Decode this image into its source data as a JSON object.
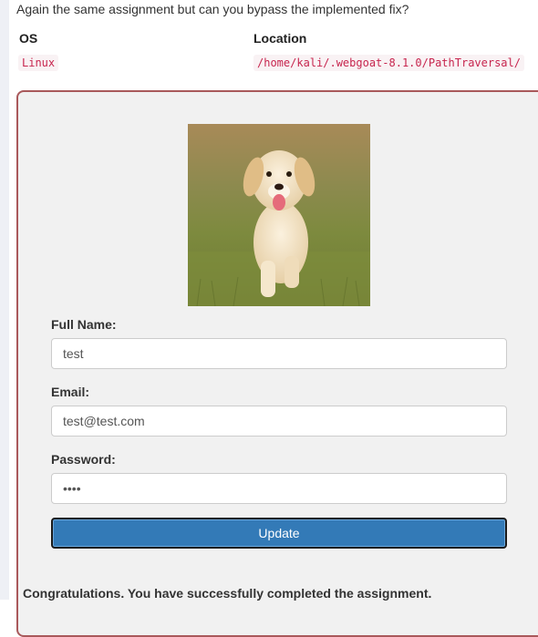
{
  "intro_text": "Again the same assignment but can you bypass the implemented fix?",
  "table": {
    "headers": [
      "OS",
      "Location"
    ],
    "row": {
      "os": "Linux",
      "location": "/home/kali/.webgoat-8.1.0/PathTraversal/"
    }
  },
  "form": {
    "avatar_icon": "dog-photo",
    "full_name_label": "Full Name:",
    "full_name_value": "test",
    "email_label": "Email:",
    "email_value": "test@test.com",
    "password_label": "Password:",
    "password_value": "test",
    "update_label": "Update"
  },
  "feedback": "Congratulations. You have successfully completed the assignment.",
  "colors": {
    "panel_border": "#a9595b",
    "button": "#337ab7",
    "code_text": "#c7254e"
  }
}
